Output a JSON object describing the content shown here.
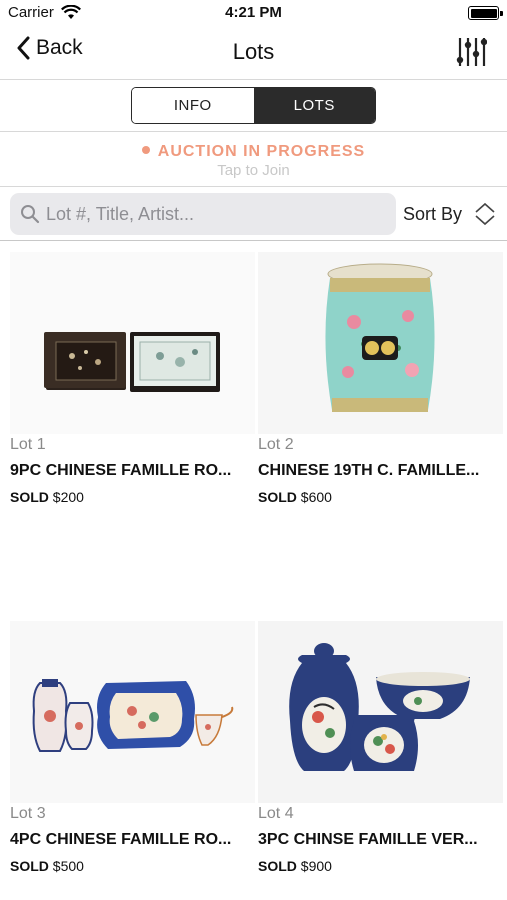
{
  "status": {
    "carrier": "Carrier",
    "time": "4:21 PM"
  },
  "nav": {
    "back_label": "Back",
    "title": "Lots",
    "filter_icon": "sliders-icon"
  },
  "segments": {
    "info": "INFO",
    "lots": "LOTS",
    "selected": "LOTS"
  },
  "banner": {
    "status": "AUCTION IN PROGRESS",
    "sub": "Tap to Join",
    "color": "#f09a7e"
  },
  "search": {
    "placeholder": "Lot #, Title, Artist...",
    "value": ""
  },
  "sort": {
    "label": "Sort By"
  },
  "lots": [
    {
      "number": "Lot 1",
      "title": "9PC CHINESE FAMILLE RO...",
      "status": "SOLD",
      "price": "$200"
    },
    {
      "number": "Lot 2",
      "title": "CHINESE 19TH C. FAMILLE...",
      "status": "SOLD",
      "price": "$600"
    },
    {
      "number": "Lot 3",
      "title": "4PC CHINESE FAMILLE RO...",
      "status": "SOLD",
      "price": "$500"
    },
    {
      "number": "Lot 4",
      "title": "3PC CHINSE FAMILLE VER...",
      "status": "SOLD",
      "price": "$900"
    }
  ]
}
